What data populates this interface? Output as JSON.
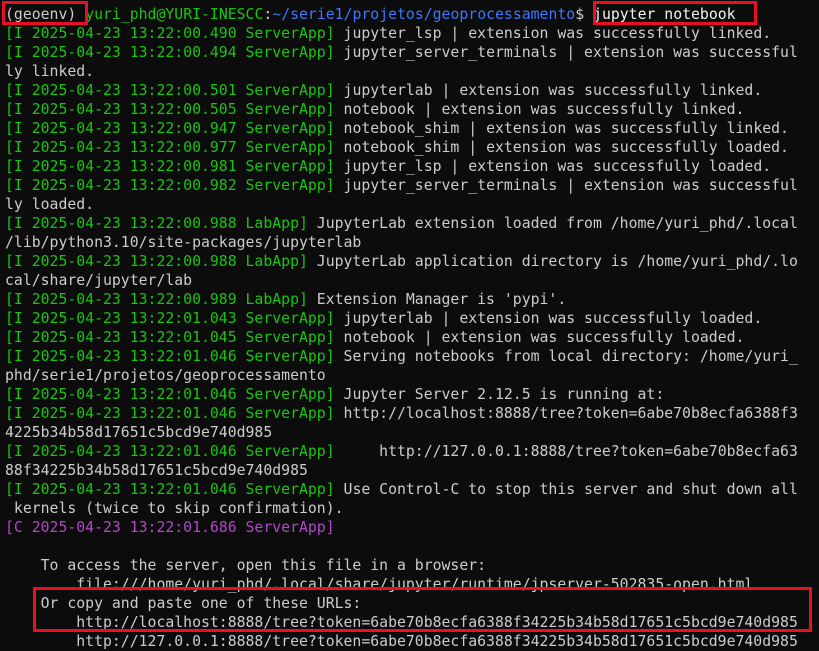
{
  "prompt": {
    "env": "(geoenv)",
    "userhost": "yuri_phd@YURI-INESCC",
    "path": "~/serie1/projetos/geoprocessamento",
    "sigil": "$",
    "command": "jupyter notebook"
  },
  "lines": [
    {
      "tag": "[I 2025-04-23 13:22:00.490 ServerApp]",
      "msg": " jupyter_lsp | extension was successfully linked."
    },
    {
      "tag": "[I 2025-04-23 13:22:00.494 ServerApp]",
      "msg": " jupyter_server_terminals | extension was successful"
    },
    {
      "tag": "",
      "msg": "ly linked."
    },
    {
      "tag": "[I 2025-04-23 13:22:00.501 ServerApp]",
      "msg": " jupyterlab | extension was successfully linked."
    },
    {
      "tag": "[I 2025-04-23 13:22:00.505 ServerApp]",
      "msg": " notebook | extension was successfully linked."
    },
    {
      "tag": "[I 2025-04-23 13:22:00.947 ServerApp]",
      "msg": " notebook_shim | extension was successfully linked."
    },
    {
      "tag": "[I 2025-04-23 13:22:00.977 ServerApp]",
      "msg": " notebook_shim | extension was successfully loaded."
    },
    {
      "tag": "[I 2025-04-23 13:22:00.981 ServerApp]",
      "msg": " jupyter_lsp | extension was successfully loaded."
    },
    {
      "tag": "[I 2025-04-23 13:22:00.982 ServerApp]",
      "msg": " jupyter_server_terminals | extension was successful"
    },
    {
      "tag": "",
      "msg": "ly loaded."
    },
    {
      "tag": "[I 2025-04-23 13:22:00.988 LabApp]",
      "msg": " JupyterLab extension loaded from /home/yuri_phd/.local"
    },
    {
      "tag": "",
      "msg": "/lib/python3.10/site-packages/jupyterlab"
    },
    {
      "tag": "[I 2025-04-23 13:22:00.988 LabApp]",
      "msg": " JupyterLab application directory is /home/yuri_phd/.lo"
    },
    {
      "tag": "",
      "msg": "cal/share/jupyter/lab"
    },
    {
      "tag": "[I 2025-04-23 13:22:00.989 LabApp]",
      "msg": " Extension Manager is 'pypi'."
    },
    {
      "tag": "[I 2025-04-23 13:22:01.043 ServerApp]",
      "msg": " jupyterlab | extension was successfully loaded."
    },
    {
      "tag": "[I 2025-04-23 13:22:01.045 ServerApp]",
      "msg": " notebook | extension was successfully loaded."
    },
    {
      "tag": "[I 2025-04-23 13:22:01.046 ServerApp]",
      "msg": " Serving notebooks from local directory: /home/yuri_"
    },
    {
      "tag": "",
      "msg": "phd/serie1/projetos/geoprocessamento"
    },
    {
      "tag": "[I 2025-04-23 13:22:01.046 ServerApp]",
      "msg": " Jupyter Server 2.12.5 is running at:"
    },
    {
      "tag": "[I 2025-04-23 13:22:01.046 ServerApp]",
      "msg": " http://localhost:8888/tree?token=6abe70b8ecfa6388f3"
    },
    {
      "tag": "",
      "msg": "4225b34b58d17651c5bcd9e740d985"
    },
    {
      "tag": "[I 2025-04-23 13:22:01.046 ServerApp]",
      "msg": "     http://127.0.0.1:8888/tree?token=6abe70b8ecfa63"
    },
    {
      "tag": "",
      "msg": "88f34225b34b58d17651c5bcd9e740d985"
    },
    {
      "tag": "[I 2025-04-23 13:22:01.046 ServerApp]",
      "msg": " Use Control-C to stop this server and shut down all"
    },
    {
      "tag": "",
      "msg": " kernels (twice to skip confirmation)."
    },
    {
      "tag": "[C 2025-04-23 13:22:01.686 ServerApp]",
      "msg": "",
      "purple": true
    },
    {
      "tag": "",
      "msg": ""
    },
    {
      "tag": "",
      "msg": "    To access the server, open this file in a browser:"
    },
    {
      "tag": "",
      "msg": "        file:///home/yuri_phd/.local/share/jupyter/runtime/jpserver-502835-open.html"
    },
    {
      "tag": "",
      "msg": "    Or copy and paste one of these URLs:"
    },
    {
      "tag": "",
      "msg": "        http://localhost:8888/tree?token=6abe70b8ecfa6388f34225b34b58d17651c5bcd9e740d985"
    },
    {
      "tag": "",
      "msg": "        http://127.0.0.1:8888/tree?token=6abe70b8ecfa6388f34225b34b58d17651c5bcd9e740d985"
    }
  ],
  "colors": {
    "background": "#0c0c0c",
    "log_tag_info": "#16c60c",
    "log_tag_critical": "#b148c6",
    "path": "#3b78ff",
    "highlight_box": "#e81123"
  }
}
